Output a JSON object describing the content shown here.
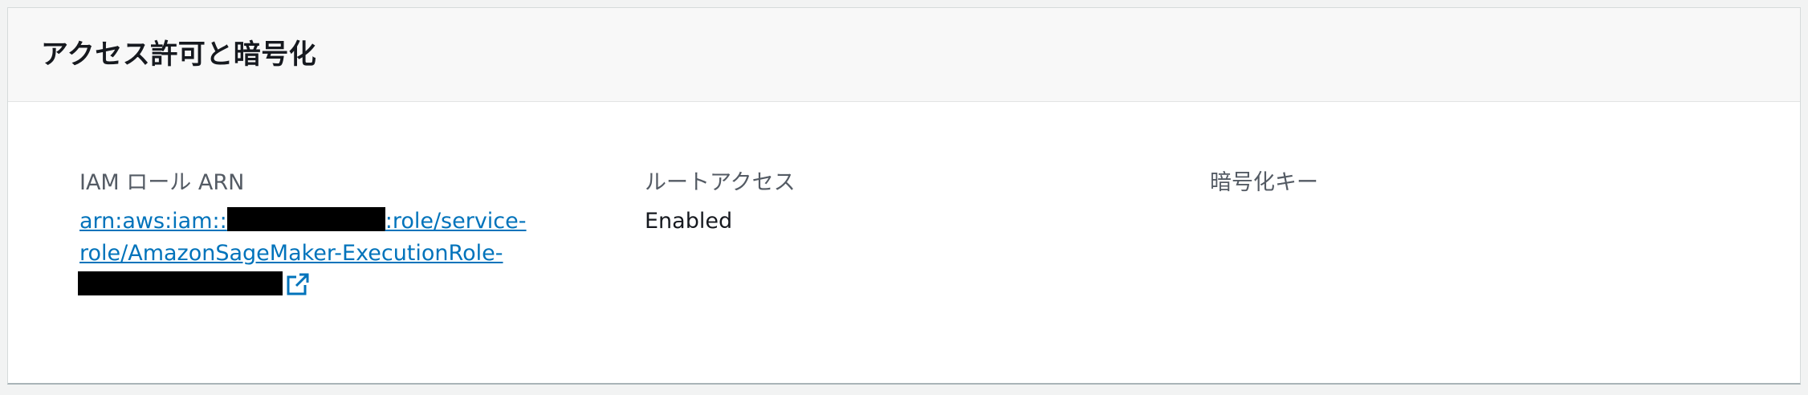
{
  "panel": {
    "title": "アクセス許可と暗号化"
  },
  "fields": {
    "iam_role": {
      "label": "IAM ロール ARN",
      "arn_prefix": "arn:aws:iam::",
      "arn_middle": ":role/service-",
      "arn_line2": "role/AmazonSageMaker-ExecutionRole-",
      "redacted_account": "redacted",
      "redacted_suffix": "redacted",
      "link_icon": "external-link-icon"
    },
    "root_access": {
      "label": "ルートアクセス",
      "value": "Enabled"
    },
    "encryption_key": {
      "label": "暗号化キー",
      "value": ""
    }
  },
  "colors": {
    "link": "#0073bb",
    "label": "#545b64",
    "text": "#16191f",
    "header_bg": "#f8f8f8"
  }
}
